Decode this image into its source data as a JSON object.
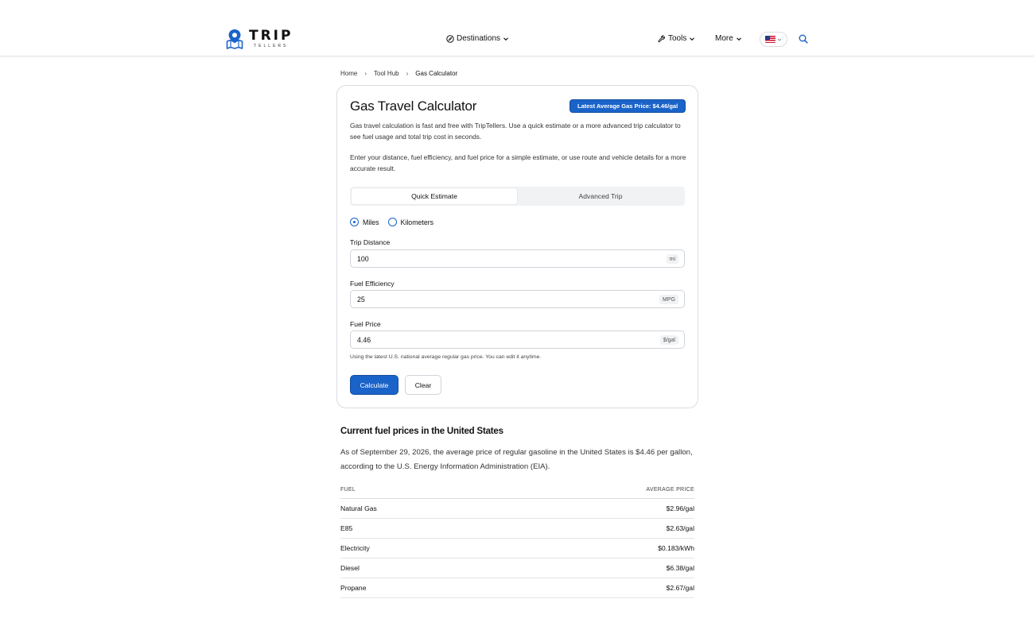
{
  "header": {
    "logo_word": "TRIP",
    "logo_sub": "TELLERS",
    "nav": {
      "destinations": "Destinations",
      "tools": "Tools",
      "more": "More"
    }
  },
  "breadcrumb": {
    "home": "Home",
    "tool_hub": "Tool Hub",
    "current": "Gas Calculator"
  },
  "calculator": {
    "title": "Gas Travel Calculator",
    "badge": "Latest Average Gas Price: $4.46/gal",
    "desc1": "Gas travel calculation is fast and free with TripTellers. Use a quick estimate or a more advanced trip calculator to see fuel usage and total trip cost in seconds.",
    "desc2": "Enter your distance, fuel efficiency, and fuel price for a simple estimate, or use route and vehicle details for a more accurate result.",
    "tabs": [
      "Quick Estimate",
      "Advanced Trip"
    ],
    "units": [
      "Miles",
      "Kilometers"
    ],
    "fields": {
      "distance": {
        "label": "Trip Distance",
        "value": "100",
        "unit": "mi"
      },
      "efficiency": {
        "label": "Fuel Efficiency",
        "value": "25",
        "unit": "MPG"
      },
      "price": {
        "label": "Fuel Price",
        "value": "4.46",
        "unit": "$/gal"
      }
    },
    "hint": "Using the latest U.S. national average regular gas price. You can edit it anytime.",
    "calculate_label": "Calculate",
    "clear_label": "Clear"
  },
  "prices": {
    "title": "Current fuel prices in the United States",
    "desc": "As of September 29, 2026, the average price of regular gasoline in the United States is $4.46 per gallon, according to the U.S. Energy Information Administration (EIA).",
    "col_fuel": "FUEL",
    "col_price": "AVERAGE PRICE",
    "rows": [
      {
        "fuel": "Natural Gas",
        "price": "$2.96/gal"
      },
      {
        "fuel": "E85",
        "price": "$2.63/gal"
      },
      {
        "fuel": "Electricity",
        "price": "$0.183/kWh"
      },
      {
        "fuel": "Diesel",
        "price": "$6.38/gal"
      },
      {
        "fuel": "Propane",
        "price": "$2.67/gal"
      }
    ]
  },
  "colors": {
    "accent": "#1a63c9"
  }
}
